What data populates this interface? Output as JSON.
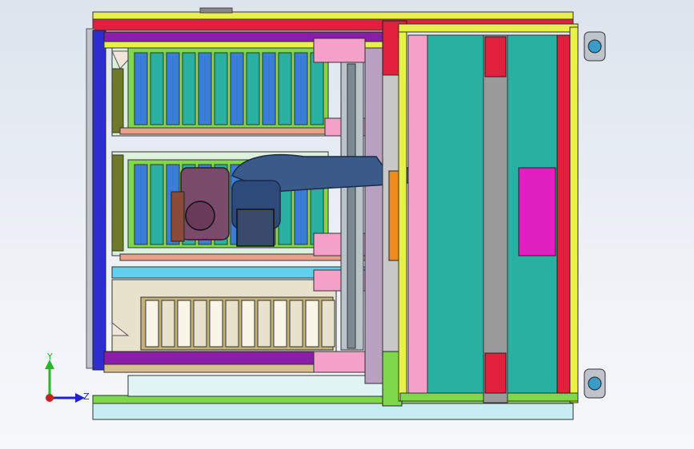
{
  "viewport": {
    "background_top": "#dde4ee",
    "background_bottom": "#f6f8fb"
  },
  "triad": {
    "y_label": "Y",
    "z_label": "Z",
    "y_color": "#2bb52b",
    "z_color": "#2222cc",
    "origin_color": "#cc2020"
  },
  "colors": {
    "frame_green": "#7ed84a",
    "frame_yellow": "#e8f04a",
    "frame_blue": "#2e2ed0",
    "frame_purple": "#8a1ea8",
    "frame_red": "#e0203c",
    "rack_teal": "#2ab0a0",
    "rack_blue": "#3a7ed8",
    "pink": "#f4a0c8",
    "robot_blue": "#3a5a8a",
    "orange": "#f08c1e",
    "magenta": "#e020c0",
    "gray": "#9a9a9a",
    "cyan": "#60d0f0"
  }
}
